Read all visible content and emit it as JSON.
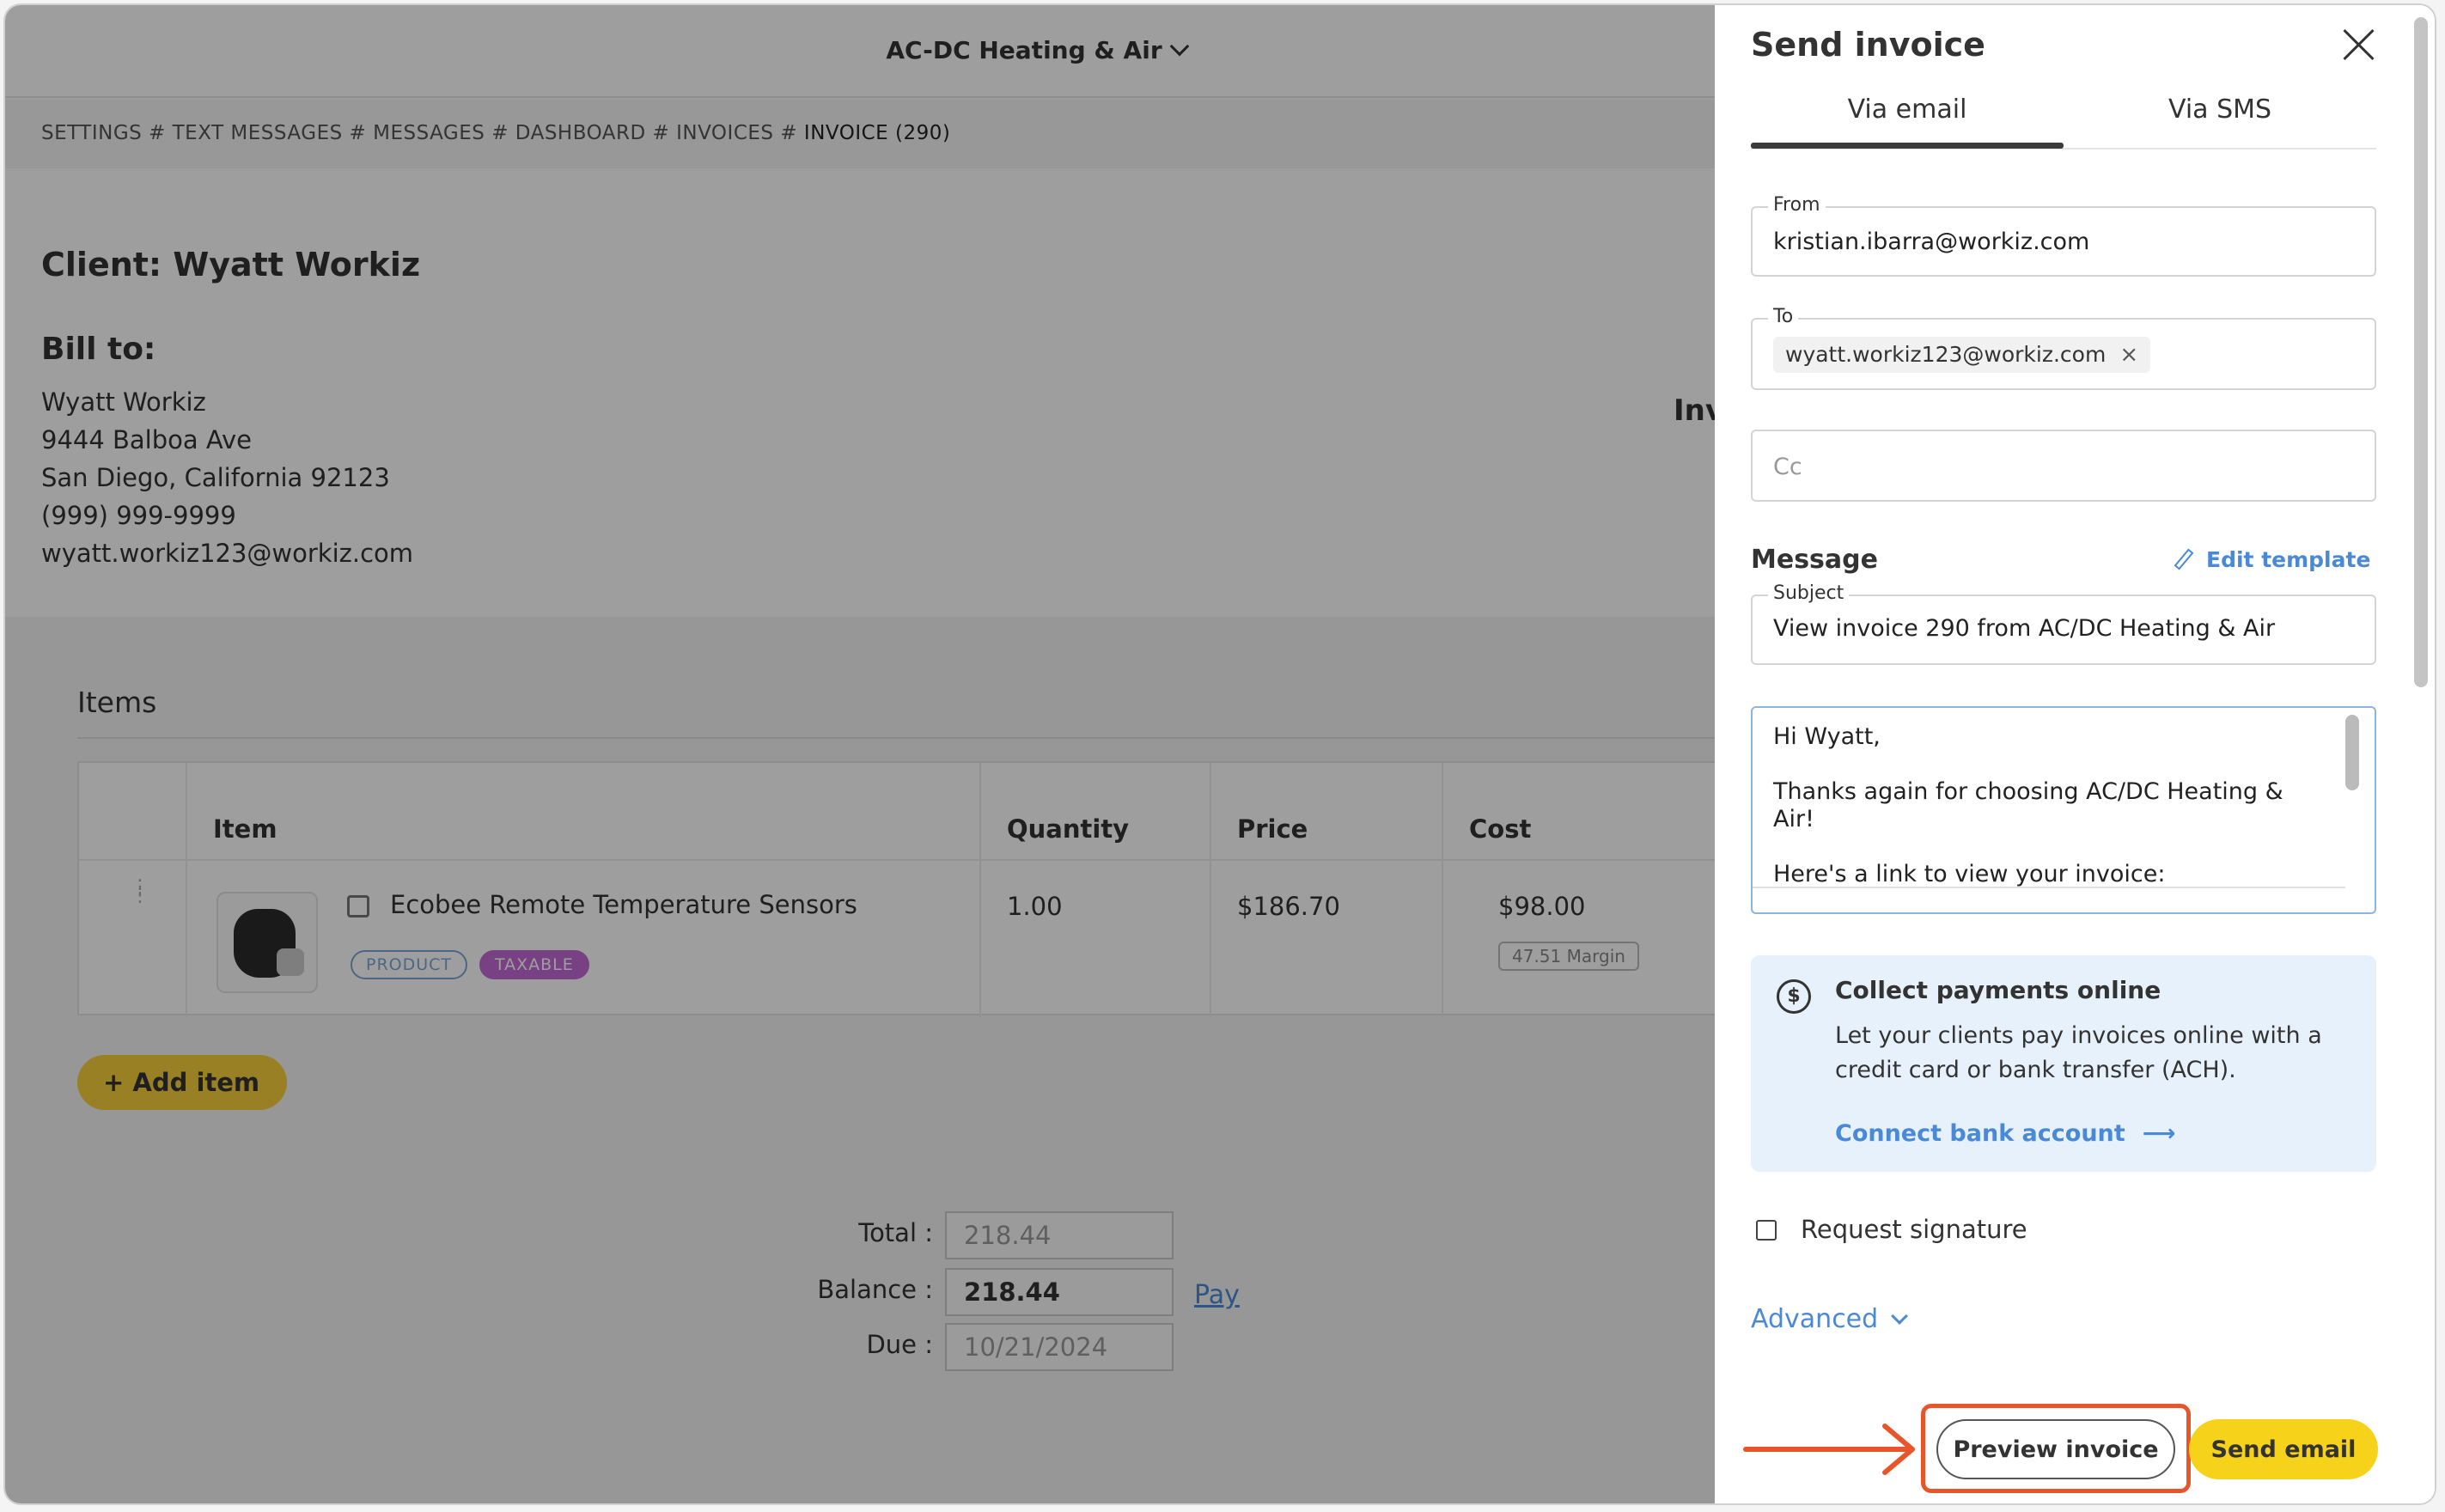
{
  "app": {
    "company": "AC-DC Heating & Air"
  },
  "breadcrumb": {
    "path": "SETTINGS # TEXT MESSAGES # MESSAGES # DASHBOARD # INVOICES #",
    "current": "INVOICE (290)"
  },
  "client": {
    "title": "Client: Wyatt Workiz",
    "bill_to_title": "Bill to:",
    "name": "Wyatt Workiz",
    "address1": "9444 Balboa Ave",
    "address2": "San Diego, California 92123",
    "phone": "(999) 999-9999",
    "email": "wyatt.workiz123@workiz.com",
    "invoice_label_partial": "Inv"
  },
  "items": {
    "title": "Items",
    "columns": [
      "Item",
      "Quantity",
      "Price",
      "Cost"
    ],
    "rows": [
      {
        "name": "Ecobee Remote Temperature Sensors",
        "tags": [
          "PRODUCT",
          "TAXABLE"
        ],
        "quantity": "1.00",
        "price": "$186.70",
        "cost": "$98.00",
        "margin": "47.51 Margin"
      }
    ],
    "add_label": "Add item"
  },
  "totals": {
    "total_label": "Total :",
    "total_value": "218.44",
    "balance_label": "Balance :",
    "balance_value": "218.44",
    "pay_link": "Pay",
    "due_label": "Due :",
    "due_value": "10/21/2024"
  },
  "panel": {
    "title": "Send invoice",
    "tabs": [
      "Via email",
      "Via SMS"
    ],
    "active_tab": "Via email",
    "from_label": "From",
    "from_value": "kristian.ibarra@workiz.com",
    "to_label": "To",
    "to_chip": "wyatt.workiz123@workiz.com",
    "cc_placeholder": "Cc",
    "message_title": "Message",
    "edit_template": "Edit template",
    "subject_label": "Subject",
    "subject_value": "View invoice 290 from AC/DC Heating & Air",
    "body": "Hi Wyatt,\n\nThanks again for choosing AC/DC Heating & Air!\n\nHere's a link to view your invoice:",
    "collect": {
      "title": "Collect payments online",
      "description": "Let your clients pay invoices online with a credit card or bank transfer (ACH).",
      "link": "Connect bank account"
    },
    "request_signature": "Request signature",
    "advanced": "Advanced",
    "preview_button": "Preview invoice",
    "send_button": "Send email"
  },
  "colors": {
    "accent_yellow": "#f7d21a",
    "link_blue": "#4a89d8",
    "highlight_orange": "#e8552a",
    "taxable_purple": "#c06ad6"
  }
}
